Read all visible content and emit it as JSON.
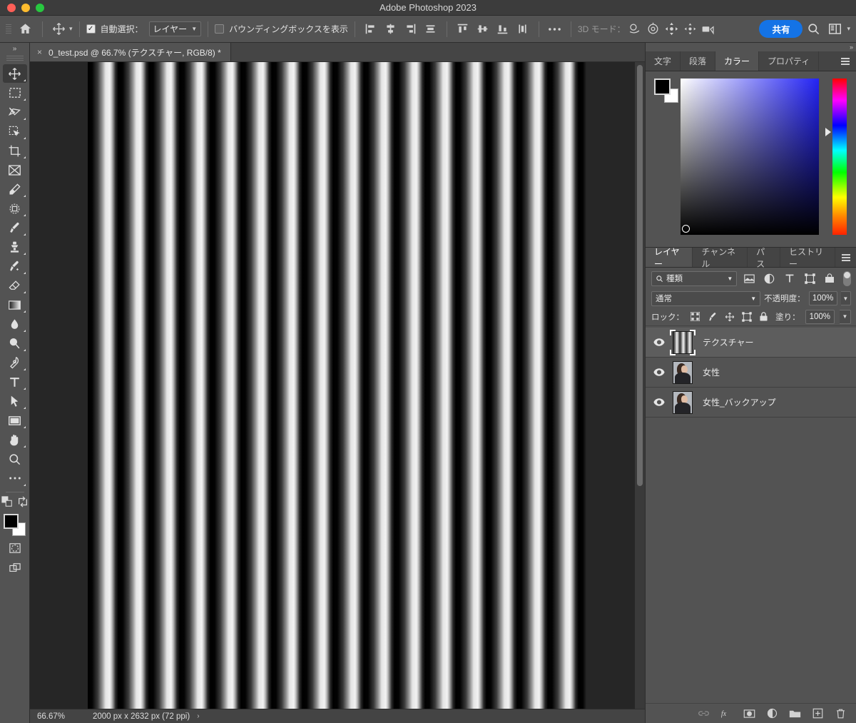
{
  "window": {
    "title": "Adobe Photoshop 2023",
    "traffic_lights": [
      "close",
      "minimize",
      "maximize"
    ]
  },
  "options_bar": {
    "home_icon": "home-icon",
    "tool_icon": "move-tool-icon",
    "auto_select_checked": true,
    "auto_select_label": "自動選択：",
    "auto_select_value": "レイヤー",
    "bounding_box_checked": false,
    "bounding_box_label": "バウンディングボックスを表示",
    "align_icons": [
      "align-left-icon",
      "align-horizontal-center-icon",
      "align-right-icon",
      "distribute-horizontal-icon",
      "align-top-icon",
      "align-vertical-center-icon",
      "align-bottom-icon",
      "distribute-vertical-icon"
    ],
    "more_label": "...",
    "mode_3d_label": "3D モード：",
    "mode_3d_icons": [
      "orbit-3d-icon",
      "roll-3d-icon",
      "pan-3d-icon",
      "slide-3d-icon",
      "camera-3d-icon"
    ],
    "share_label": "共有",
    "search_icon": "search-icon",
    "workspace_icon": "workspace-icon",
    "workspace_chevron": "chevron-down-icon"
  },
  "toolbar": {
    "expand_label": "»",
    "tools": [
      {
        "name": "move-tool",
        "icon": "move-icon",
        "active": true,
        "has_flyout": true
      },
      {
        "name": "rectangular-marquee-tool",
        "icon": "marquee-icon",
        "active": false,
        "has_flyout": true
      },
      {
        "name": "lasso-tool",
        "icon": "lasso-icon",
        "active": false,
        "has_flyout": true
      },
      {
        "name": "object-selection-tool",
        "icon": "object-select-icon",
        "active": false,
        "has_flyout": true
      },
      {
        "name": "crop-tool",
        "icon": "crop-icon",
        "active": false,
        "has_flyout": true
      },
      {
        "name": "frame-tool",
        "icon": "frame-icon",
        "active": false,
        "has_flyout": false
      },
      {
        "name": "eyedropper-tool",
        "icon": "eyedropper-icon",
        "active": false,
        "has_flyout": true
      },
      {
        "name": "spot-healing-brush-tool",
        "icon": "healing-brush-icon",
        "active": false,
        "has_flyout": true
      },
      {
        "name": "brush-tool",
        "icon": "brush-icon",
        "active": false,
        "has_flyout": true
      },
      {
        "name": "clone-stamp-tool",
        "icon": "clone-stamp-icon",
        "active": false,
        "has_flyout": true
      },
      {
        "name": "history-brush-tool",
        "icon": "history-brush-icon",
        "active": false,
        "has_flyout": true
      },
      {
        "name": "eraser-tool",
        "icon": "eraser-icon",
        "active": false,
        "has_flyout": true
      },
      {
        "name": "gradient-tool",
        "icon": "gradient-icon",
        "active": false,
        "has_flyout": true
      },
      {
        "name": "blur-tool",
        "icon": "blur-icon",
        "active": false,
        "has_flyout": true
      },
      {
        "name": "dodge-tool",
        "icon": "dodge-icon",
        "active": false,
        "has_flyout": true
      },
      {
        "name": "pen-tool",
        "icon": "pen-icon",
        "active": false,
        "has_flyout": true
      },
      {
        "name": "type-tool",
        "icon": "type-icon",
        "active": false,
        "has_flyout": true
      },
      {
        "name": "path-selection-tool",
        "icon": "path-select-icon",
        "active": false,
        "has_flyout": true
      },
      {
        "name": "rectangle-tool",
        "icon": "rectangle-icon",
        "active": false,
        "has_flyout": true
      },
      {
        "name": "hand-tool",
        "icon": "hand-icon",
        "active": false,
        "has_flyout": true
      },
      {
        "name": "zoom-tool",
        "icon": "zoom-icon",
        "active": false,
        "has_flyout": false
      },
      {
        "name": "edit-toolbar",
        "icon": "ellipsis-icon",
        "active": false,
        "has_flyout": true
      }
    ],
    "default-colors-icon": "default-colors-icon",
    "swap-colors-icon": "swap-colors-icon",
    "foreground_color": "#000000",
    "background_color": "#ffffff",
    "quick_mask_icon": "quick-mask-icon",
    "screen_mode_icon": "screen-mode-icon"
  },
  "document": {
    "tab_label": "0_test.psd @ 66.7% (テクスチャー, RGB/8) *",
    "close_icon": "close-icon"
  },
  "status_bar": {
    "zoom": "66.67%",
    "dimensions": "2000 px x 2632 px (72 ppi)",
    "chevron": "›"
  },
  "color_panel": {
    "tabs": [
      {
        "label": "文字",
        "active": false
      },
      {
        "label": "段落",
        "active": false
      },
      {
        "label": "カラー",
        "active": true
      },
      {
        "label": "プロパティ",
        "active": false
      }
    ],
    "menu_icon": "panel-menu-icon",
    "foreground_color": "#000000",
    "background_color": "#ffffff",
    "field_gradient_color": "#2323f5",
    "picker_icon": "color-picker-handle-icon",
    "hue_marker_icon": "hue-slider-marker-icon"
  },
  "layers_panel": {
    "tabs": [
      {
        "label": "レイヤー",
        "active": true
      },
      {
        "label": "チャンネル",
        "active": false
      },
      {
        "label": "パス",
        "active": false
      },
      {
        "label": "ヒストリー",
        "active": false
      }
    ],
    "menu_icon": "panel-menu-icon",
    "filter": {
      "search_icon": "search-icon",
      "value": "種類",
      "chevron": "chevron-down-icon",
      "type_icons": [
        "filter-pixel-icon",
        "filter-adjustment-icon",
        "filter-type-icon",
        "filter-shape-icon",
        "filter-smart-object-icon"
      ],
      "toggle_icon": "filter-toggle-icon"
    },
    "blend_mode": "通常",
    "opacity_label": "不透明度：",
    "opacity_value": "100%",
    "lock_label": "ロック：",
    "lock_icons": [
      "lock-transparent-pixels-icon",
      "lock-image-pixels-icon",
      "lock-position-icon",
      "lock-artboard-nesting-icon",
      "lock-all-icon"
    ],
    "fill_label": "塗り：",
    "fill_value": "100%",
    "layers": [
      {
        "name": "テクスチャー",
        "visible": true,
        "selected": true,
        "thumb": "stripes",
        "eye_icon": "eye-icon"
      },
      {
        "name": "女性",
        "visible": true,
        "selected": false,
        "thumb": "portrait",
        "eye_icon": "eye-icon"
      },
      {
        "name": "女性_バックアップ",
        "visible": true,
        "selected": false,
        "thumb": "portrait",
        "eye_icon": "eye-icon"
      }
    ],
    "footer_icons": [
      {
        "name": "link-layers-icon",
        "glyph": "link"
      },
      {
        "name": "layer-style-fx-icon",
        "glyph": "fx"
      },
      {
        "name": "add-layer-mask-icon",
        "glyph": "mask"
      },
      {
        "name": "new-adjustment-layer-icon",
        "glyph": "adjustment"
      },
      {
        "name": "new-group-icon",
        "glyph": "folder"
      },
      {
        "name": "new-layer-icon",
        "glyph": "plus"
      },
      {
        "name": "delete-layer-icon",
        "glyph": "trash"
      }
    ]
  },
  "canvas": {
    "content_description": "vertical-gradient-stripe-texture",
    "background_color": "#262626"
  }
}
